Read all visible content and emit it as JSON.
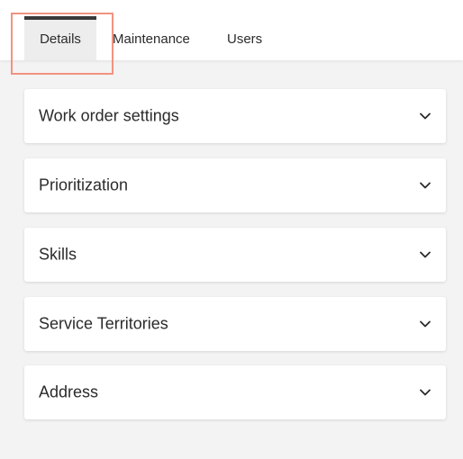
{
  "tabs": [
    {
      "label": "Details",
      "active": true
    },
    {
      "label": "Maintenance",
      "active": false
    },
    {
      "label": "Users",
      "active": false
    }
  ],
  "sections": [
    {
      "title": "Work order settings",
      "icon": "chevron-down-icon"
    },
    {
      "title": "Prioritization",
      "icon": "chevron-down-icon"
    },
    {
      "title": "Skills",
      "icon": "chevron-down-icon"
    },
    {
      "title": "Service Territories",
      "icon": "chevron-down-icon"
    },
    {
      "title": "Address",
      "icon": "chevron-down-icon"
    }
  ],
  "colors": {
    "highlight": "#f2937f",
    "active_tab_bg": "#ededed",
    "active_tab_border": "#3a3a3a",
    "page_bg": "#f3f3f3"
  }
}
